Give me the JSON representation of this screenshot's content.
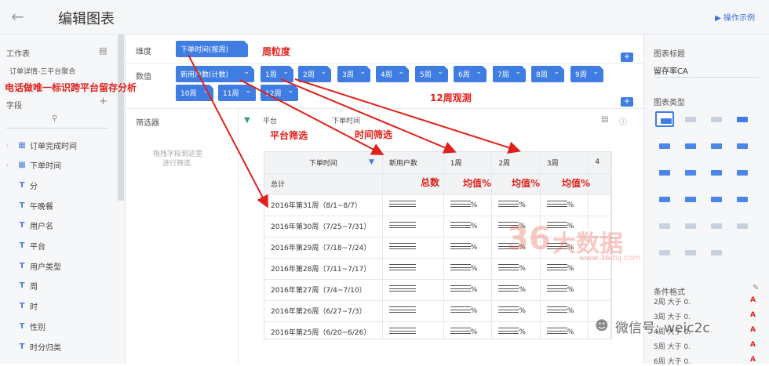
{
  "header": {
    "title": "编辑图表",
    "help_link": "操作示例"
  },
  "left_panel": {
    "worksheet_label": "工作表",
    "worksheet_name": "订单详情-三平台聚合",
    "fields_label": "字段",
    "fields": [
      {
        "type": "date",
        "name": "订单完成时间"
      },
      {
        "type": "date",
        "name": "下单时间"
      },
      {
        "type": "T",
        "name": "分"
      },
      {
        "type": "T",
        "name": "午晚餐"
      },
      {
        "type": "T",
        "name": "用户名"
      },
      {
        "type": "T",
        "name": "平台"
      },
      {
        "type": "T",
        "name": "用户类型"
      },
      {
        "type": "T",
        "name": "周"
      },
      {
        "type": "T",
        "name": "时"
      },
      {
        "type": "T",
        "name": "性别"
      },
      {
        "type": "T",
        "name": "时分归类"
      }
    ]
  },
  "editor": {
    "dimension_label": "维度",
    "dimension_chip": "下单时间(按周)",
    "value_label": "数值",
    "value_chips": [
      "新用户数(计数)",
      "1周",
      "2周",
      "3周",
      "4周",
      "5周",
      "6周",
      "7周",
      "8周",
      "9周",
      "10周",
      "11周",
      "12周"
    ],
    "filter_label": "筛选器",
    "filter_hint_line1": "拖拽字段到这里",
    "filter_hint_line2": "进行筛选",
    "filter_chips": [
      "平台",
      "下单时间"
    ]
  },
  "table": {
    "headers": [
      "下单时间",
      "新用户数",
      "1周",
      "2周",
      "3周",
      "4"
    ],
    "summary_label": "总计",
    "rows": [
      "2016年第31周（8/1~8/7）",
      "2016年第30周（7/25~7/31）",
      "2016年第29周（7/18~7/24）",
      "2016年第28周（7/11~7/17）",
      "2016年第27周（7/4~7/10）",
      "2016年第26周（6/27~7/3）",
      "2016年第25周（6/20~6/26）"
    ],
    "percent_suffix": "%"
  },
  "annotations": {
    "week_granularity": "周粒度",
    "retention_analysis": "电话做唯一标识跨平台留存分析",
    "twelve_weeks": "12周观测",
    "platform_filter": "平台筛选",
    "time_filter": "时间筛选",
    "total": "总数",
    "avg1": "均值%",
    "avg2": "均值%",
    "avg3": "均值%"
  },
  "right_panel": {
    "chart_title_label": "图表标题",
    "chart_title_value": "留存率CA",
    "chart_type_label": "图表类型",
    "cond_format_label": "条件格式",
    "cond_items": [
      "2周 大于 0.",
      "3周 大于 0.",
      "4周 大于 0.",
      "5周 大于 0.",
      "6周 大于 0."
    ]
  },
  "watermark": {
    "brand": "大数据",
    "url": "www.36dsj.com",
    "wechat": "微信号: weic2c"
  },
  "colors": {
    "accent": "#3f7de3",
    "annotation": "#e0201a"
  }
}
